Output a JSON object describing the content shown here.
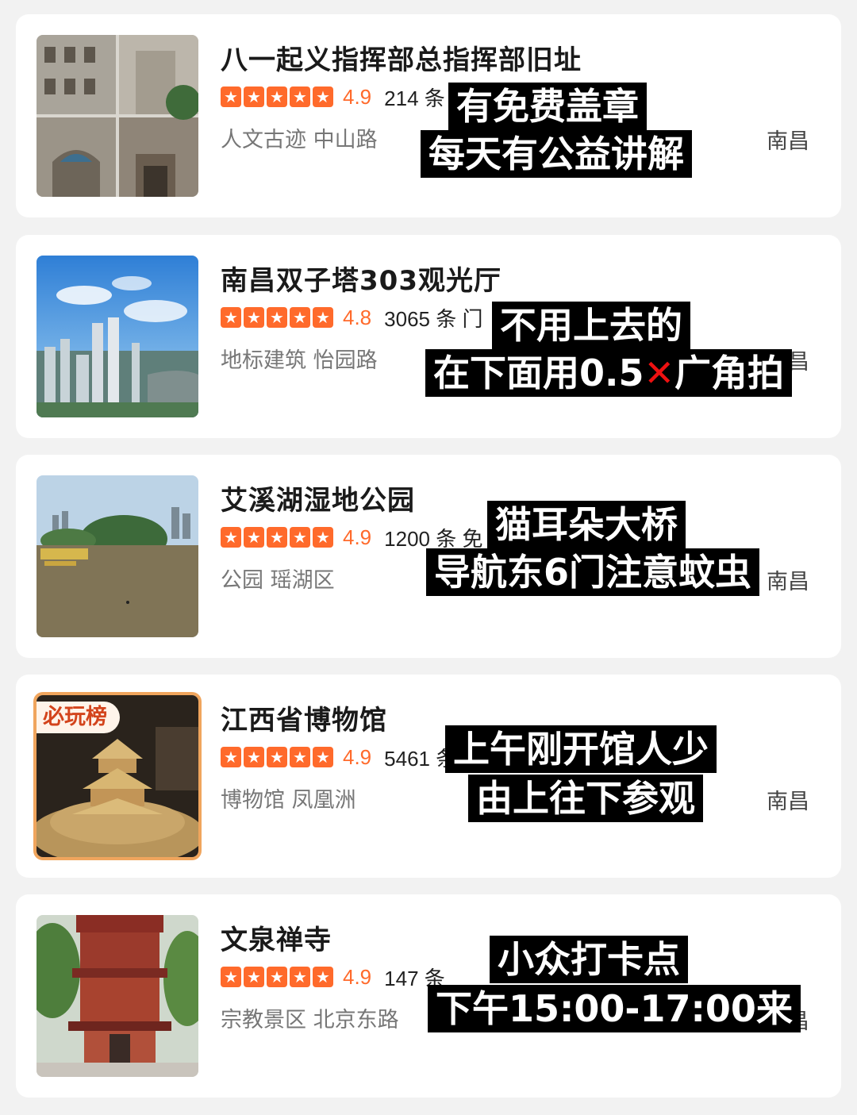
{
  "cards": [
    {
      "title": "八一起义指挥部总指挥部旧址",
      "score": "4.9",
      "reviews": "214 条",
      "tags": "人文古迹 中山路",
      "city": "南昌",
      "notes": [
        "有免费盖章",
        "每天有公益讲解"
      ]
    },
    {
      "title": "南昌双子塔303观光厅",
      "score": "4.8",
      "reviews": "3065 条 门",
      "tags": "地标建筑 怡园路",
      "city": "南昌",
      "notes": [
        "不用上去的",
        "在下面用0.5",
        "广角拍"
      ]
    },
    {
      "title": "艾溪湖湿地公园",
      "score": "4.9",
      "reviews": "1200 条 免",
      "tags": "公园 瑶湖区",
      "city": "南昌",
      "notes": [
        "猫耳朵大桥",
        "导航东6门注意蚊虫"
      ]
    },
    {
      "title": "江西省博物馆",
      "score": "4.9",
      "reviews": "5461 条",
      "tags": "博物馆 凤凰洲",
      "city": "南昌",
      "badge": "必玩榜",
      "notes": [
        "上午刚开馆人少",
        "由上往下参观"
      ]
    },
    {
      "title": "文泉禅寺",
      "score": "4.9",
      "reviews": "147 条",
      "tags": "宗教景区 北京东路",
      "city": "南昌",
      "notes": [
        "小众打卡点",
        "下午15:00-17:00来"
      ]
    }
  ],
  "icons": {
    "star": "star-icon",
    "cross": "red-cross-mark"
  },
  "colors": {
    "accent": "#ff6a2b",
    "note_bg": "#000000",
    "cross": "#e11111"
  }
}
